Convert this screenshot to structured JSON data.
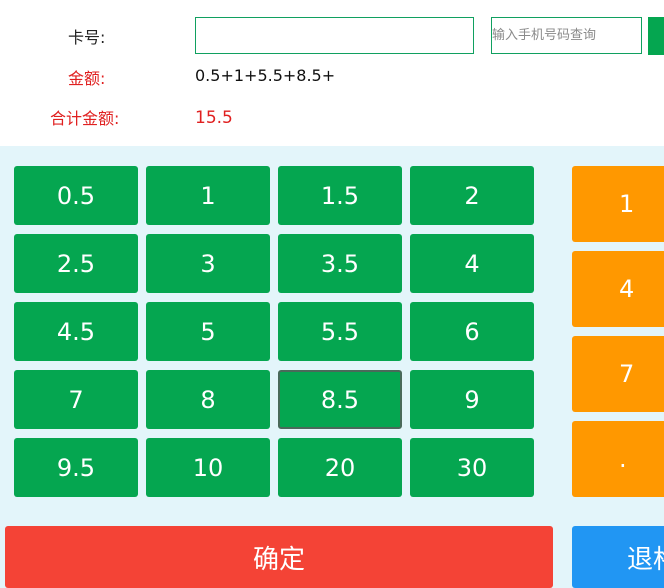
{
  "form": {
    "card_label": "卡号:",
    "card_value": "",
    "phone_placeholder": "输入手机号码查询",
    "amount_label": "金额:",
    "amount_expression": "0.5+1+5.5+8.5+",
    "total_label": "合计金额:",
    "total_value": "15.5"
  },
  "keypad": {
    "amount_keys": [
      "0.5",
      "1",
      "1.5",
      "2",
      "2.5",
      "3",
      "3.5",
      "4",
      "4.5",
      "5",
      "5.5",
      "6",
      "7",
      "8",
      "8.5",
      "9",
      "9.5",
      "10",
      "20",
      "30"
    ],
    "selected_key": "8.5",
    "digit_keys": [
      "1",
      "4",
      "7",
      "."
    ]
  },
  "actions": {
    "confirm_label": "确定",
    "back_label": "退格"
  },
  "colors": {
    "amount_key": "#05a650",
    "digit_key": "#ff9800",
    "confirm": "#f44336",
    "back": "#2196f3",
    "alert_text": "#e02020"
  }
}
